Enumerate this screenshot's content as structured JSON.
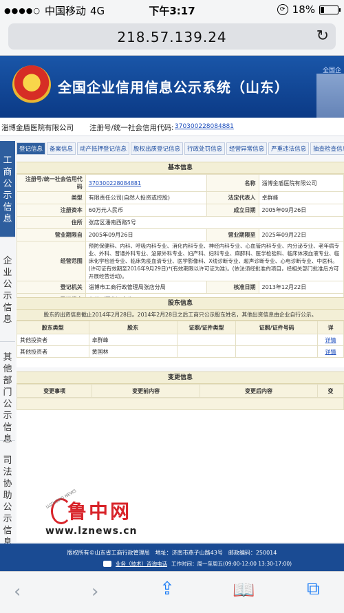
{
  "status": {
    "carrier": "中国移动",
    "network": "4G",
    "time": "下午3:17",
    "battery": "18%",
    "battery_level": 0.18
  },
  "browser": {
    "url": "218.57.139.24"
  },
  "site": {
    "title": "全国企业信用信息公示系统（山东）",
    "header_link": "全国企"
  },
  "company": {
    "name": "淄博金盾医院有限公司",
    "reg_label": "注册号/统一社会信用代码:",
    "reg_value": "370300228084881"
  },
  "left_nav": {
    "items": [
      "工商公示信息",
      "企业公示信息",
      "其他部门公示信息",
      "司法协助公示信息"
    ]
  },
  "tabs": [
    "登记信息",
    "备案信息",
    "动产抵押登记信息",
    "股权出质登记信息",
    "行政处罚信息",
    "经营异常信息",
    "严重违法信息",
    "抽查检查信息"
  ],
  "basic": {
    "title": "基本信息",
    "reg_no_label": "注册号/统一社会信用代码",
    "reg_no": "370300228084881",
    "name_label": "名称",
    "name": "淄博金盾医院有限公司",
    "type_label": "类型",
    "type": "有限责任公司(自然人投资或控股)",
    "rep_label": "法定代表人",
    "rep": "卓群峰",
    "capital_label": "注册资本",
    "capital": "60万元人民币",
    "est_label": "成立日期",
    "est": "2005年09月26日",
    "address_label": "住所",
    "address": "张店区潘南西路5号",
    "term_from_label": "营业期限自",
    "term_from": "2005年09月26日",
    "term_to_label": "营业期限至",
    "term_to": "2025年09月22日",
    "scope_label": "经营范围",
    "scope": "预防保健科、内科、呼吸内科专业、消化内科专业、神经内科专业、心血管内科专业、内分泌专业、老年病专业、外科、普通外科专业、泌尿外科专业、妇产科、妇科专业、麻醉科、医学检验科、临床体液血液专业、临床化学检验专业、临床免疫血清专业、医学影像科、X线诊断专业、超声诊断专业、心电诊断专业、中医科。(许可证有效期至2016年9月29日)*(有效期限以许可证为准)。(依法须经批准的项目，经相关部门批准后方可开展经营活动)。",
    "authority_label": "登记机关",
    "authority": "淄博市工商行政管理局张店分局",
    "approve_label": "核准日期",
    "approve": "2013年12月22日",
    "status_label": "登记状态",
    "status": "在营（开业）企业"
  },
  "shareholders": {
    "title": "股东信息",
    "note": "股东的出资信息截止2014年2月28日。2014年2月28日之后工商只公示股东姓名，其他出资信息由企业自行公示。",
    "columns": [
      "股东类型",
      "股东",
      "证照/证件类型",
      "证照/证件号码",
      "详"
    ],
    "rows": [
      {
        "type": "其他投资者",
        "name": "卓群峰",
        "id_type": "",
        "id_no": "",
        "detail": "详情"
      },
      {
        "type": "其他投资者",
        "name": "黄国林",
        "id_type": "",
        "id_no": "",
        "detail": "详情"
      }
    ]
  },
  "changes": {
    "title": "变更信息",
    "columns": [
      "变更事项",
      "变更前内容",
      "变更后内容",
      "变"
    ]
  },
  "watermark": {
    "brand": "鲁中网",
    "arc_text": "LUZHONG NEWS",
    "url": "www.lznews.cn"
  },
  "footer": {
    "line1": "版权所有©山东省工商行政管理局　地址：济南市燕子山路43号　邮政编码：250014",
    "hotline": "业务（技术）咨询电话",
    "hours": "工作时间：周一至周五(09:00-12:00 13:30-17:00)"
  }
}
